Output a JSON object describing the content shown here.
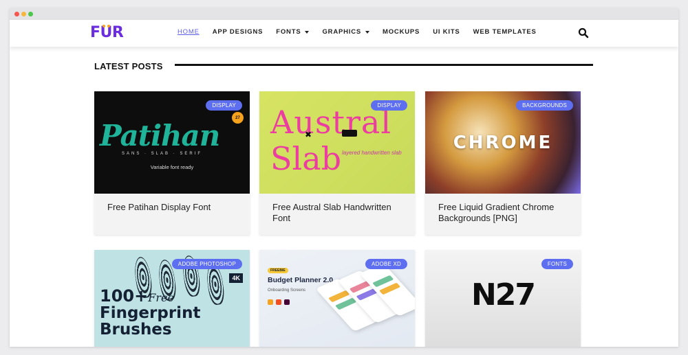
{
  "logo": "FUR",
  "nav": {
    "items": [
      {
        "label": "HOME",
        "active": true,
        "dropdown": false
      },
      {
        "label": "APP DESIGNS",
        "active": false,
        "dropdown": false
      },
      {
        "label": "FONTS",
        "active": false,
        "dropdown": true
      },
      {
        "label": "GRAPHICS",
        "active": false,
        "dropdown": true
      },
      {
        "label": "MOCKUPS",
        "active": false,
        "dropdown": false
      },
      {
        "label": "UI KITS",
        "active": false,
        "dropdown": false
      },
      {
        "label": "WEB TEMPLATES",
        "active": false,
        "dropdown": false
      }
    ],
    "search_icon": "search-icon"
  },
  "section": {
    "title": "LATEST POSTS"
  },
  "posts": [
    {
      "badge": "DISPLAY",
      "title": "Free Patihan Display Font",
      "thumb": {
        "big": "Patihan",
        "sub": "SANS · SLAB · SERIF",
        "tagline": "Variable font ready",
        "circle": "27"
      }
    },
    {
      "badge": "DISPLAY",
      "title": "Free Austral Slab Handwritten Font",
      "thumb": {
        "line1": "Austral",
        "line2": "Slab",
        "side": "layered handwritten slab"
      }
    },
    {
      "badge": "BACKGROUNDS",
      "title": "Free Liquid Gradient Chrome Backgrounds [PNG]",
      "thumb": {
        "big": "CHROME"
      }
    },
    {
      "badge": "ADOBE PHOTOSHOP",
      "title": "",
      "thumb": {
        "count": "100+",
        "free": "Free",
        "line2": "Fingerprint",
        "line3": "Brushes",
        "res": "4K"
      }
    },
    {
      "badge": "ADOBE XD",
      "title": "",
      "thumb": {
        "tag": "FREEBIE",
        "title": "Budget Planner 2.0",
        "sub": "Onboarding Screens"
      }
    },
    {
      "badge": "FONTS",
      "title": "",
      "thumb": {
        "big": "N27"
      }
    }
  ],
  "colors": {
    "accent": "#5d6ef0",
    "logo": "#6a2ee0",
    "nav_active": "#5d5ee8"
  }
}
